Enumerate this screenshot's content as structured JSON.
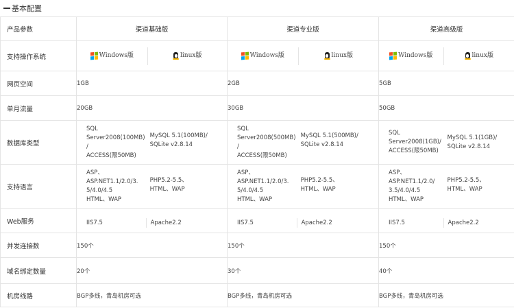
{
  "section": {
    "title": "基本配置"
  },
  "columns": [
    "产品参数",
    "渠道基础版",
    "渠道专业版",
    "渠道高级版"
  ],
  "os": {
    "label": "支持操作系统",
    "windows": "Windows版",
    "linux": "linux版",
    "colors": {
      "win_red": "#f25022",
      "win_green": "#7fba00",
      "win_blue": "#00a4ef",
      "win_yellow": "#ffb900"
    }
  },
  "rows": {
    "space": {
      "label": "网页空间",
      "values": [
        "1GB",
        "2GB",
        "5GB"
      ]
    },
    "traffic": {
      "label": "单月流量",
      "values": [
        "20GB",
        "30GB",
        "50GB"
      ]
    },
    "db": {
      "label": "数据库类型",
      "basic": {
        "a1": "SQL Server2008(100MB)",
        "a2": "/",
        "a3": "ACCESS(限50MB)",
        "b1": "MySQL 5.1(100MB)/",
        "b2": "SQLite v2.8.14"
      },
      "pro": {
        "a1": "SQL Server2008(500MB)",
        "a2": "/",
        "a3": "ACCESS(限50MB)",
        "b1": "MySQL 5.1(500MB)/",
        "b2": "SQLite v2.8.14"
      },
      "adv": {
        "a1": "SQL Server2008(1GB)/",
        "a2": "ACCESS(限50MB)",
        "b1": "MySQL 5.1(1GB)/",
        "b2": "SQLite v2.8.14"
      }
    },
    "lang": {
      "label": "支持语言",
      "basic": {
        "a1": "ASP、ASP.NET1.1/2.0/3.",
        "a2": "5/4.0/4.5",
        "a3": "HTML、WAP",
        "b1": "PHP5.2-5.5、",
        "b2": "HTML、WAP"
      },
      "pro": {
        "a1": "ASP、ASP.NET1.1/2.0/3.",
        "a2": "5/4.0/4.5",
        "a3": "HTML、WAP",
        "b1": "PHP5.2-5.5、",
        "b2": "HTML、WAP"
      },
      "adv": {
        "a1": "ASP、ASP.NET1.1/2.0/",
        "a2": "3.5/4.0/4.5",
        "a3": "HTML、WAP",
        "b1": "PHP5.2-5.5、",
        "b2": "HTML、WAP"
      }
    },
    "web": {
      "label": "Web服务",
      "iis": "IIS7.5",
      "apache": "Apache2.2"
    },
    "conn": {
      "label": "并发连接数",
      "values": [
        "150个",
        "150个",
        "150个"
      ]
    },
    "domains": {
      "label": "域名绑定数量",
      "values": [
        "20个",
        "30个",
        "40个"
      ]
    },
    "line": {
      "label": "机房线路",
      "values": [
        "BGP多线，青岛机房可选",
        "BGP多线，青岛机房可选",
        "BGP多线，青岛机房可选"
      ]
    }
  }
}
